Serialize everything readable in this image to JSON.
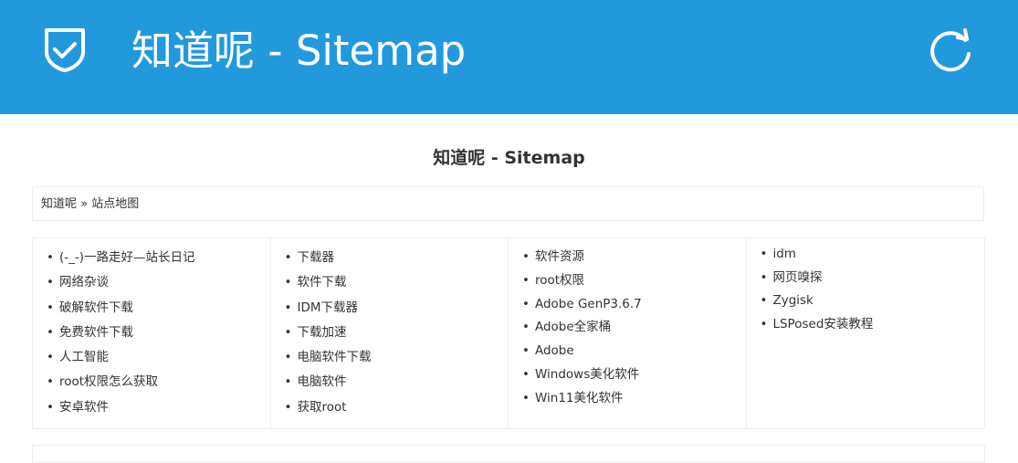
{
  "appbar": {
    "title": "知道呢 - Sitemap",
    "background": "#2299dd",
    "icon": "shield-check-icon",
    "refresh_icon": "refresh-icon"
  },
  "page": {
    "title": "知道呢 - Sitemap"
  },
  "breadcrumb": {
    "home": "知道呢",
    "separator": "»",
    "current": "站点地图"
  },
  "columns": [
    [
      "(-_-)一路走好—站长日记",
      "网络杂谈",
      "破解软件下载",
      "免费软件下载",
      "人工智能",
      "root权限怎么获取",
      "安卓软件"
    ],
    [
      "下载器",
      "软件下载",
      "IDM下载器",
      "下载加速",
      "电脑软件下载",
      "电脑软件",
      "获取root"
    ],
    [
      "软件资源",
      "root权限",
      "Adobe GenP3.6.7",
      "Adobe全家桶",
      "Adobe",
      "Windows美化软件",
      "Win11美化软件"
    ],
    [
      "idm",
      "网页嗅探",
      "Zygisk",
      "LSPosed安装教程"
    ]
  ]
}
